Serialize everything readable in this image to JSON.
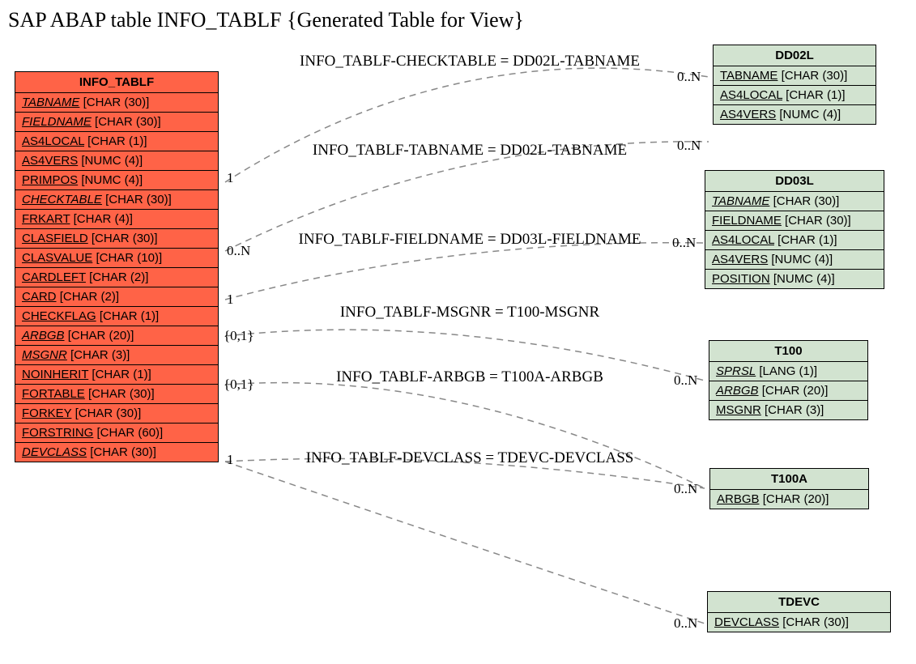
{
  "title": "SAP ABAP table INFO_TABLF {Generated Table for View}",
  "main_entity": {
    "name": "INFO_TABLF",
    "fields": [
      {
        "name": "TABNAME",
        "type": "[CHAR (30)]",
        "italic": true
      },
      {
        "name": "FIELDNAME",
        "type": "[CHAR (30)]",
        "italic": true
      },
      {
        "name": "AS4LOCAL",
        "type": "[CHAR (1)]"
      },
      {
        "name": "AS4VERS",
        "type": "[NUMC (4)]"
      },
      {
        "name": "PRIMPOS",
        "type": "[NUMC (4)]"
      },
      {
        "name": "CHECKTABLE",
        "type": "[CHAR (30)]",
        "italic": true
      },
      {
        "name": "FRKART",
        "type": "[CHAR (4)]"
      },
      {
        "name": "CLASFIELD",
        "type": "[CHAR (30)]"
      },
      {
        "name": "CLASVALUE",
        "type": "[CHAR (10)]"
      },
      {
        "name": "CARDLEFT",
        "type": "[CHAR (2)]"
      },
      {
        "name": "CARD",
        "type": "[CHAR (2)]"
      },
      {
        "name": "CHECKFLAG",
        "type": "[CHAR (1)]"
      },
      {
        "name": "ARBGB",
        "type": "[CHAR (20)]",
        "italic": true
      },
      {
        "name": "MSGNR",
        "type": "[CHAR (3)]",
        "italic": true
      },
      {
        "name": "NOINHERIT",
        "type": "[CHAR (1)]"
      },
      {
        "name": "FORTABLE",
        "type": "[CHAR (30)]"
      },
      {
        "name": "FORKEY",
        "type": "[CHAR (30)]"
      },
      {
        "name": "FORSTRING",
        "type": "[CHAR (60)]"
      },
      {
        "name": "DEVCLASS",
        "type": "[CHAR (30)]",
        "italic": true
      }
    ]
  },
  "ref_entities": [
    {
      "name": "DD02L",
      "fields": [
        {
          "name": "TABNAME",
          "type": "[CHAR (30)]"
        },
        {
          "name": "AS4LOCAL",
          "type": "[CHAR (1)]"
        },
        {
          "name": "AS4VERS",
          "type": "[NUMC (4)]"
        }
      ]
    },
    {
      "name": "DD03L",
      "fields": [
        {
          "name": "TABNAME",
          "type": "[CHAR (30)]",
          "italic": true
        },
        {
          "name": "FIELDNAME",
          "type": "[CHAR (30)]"
        },
        {
          "name": "AS4LOCAL",
          "type": "[CHAR (1)]"
        },
        {
          "name": "AS4VERS",
          "type": "[NUMC (4)]"
        },
        {
          "name": "POSITION",
          "type": "[NUMC (4)]"
        }
      ]
    },
    {
      "name": "T100",
      "fields": [
        {
          "name": "SPRSL",
          "type": "[LANG (1)]",
          "italic": true
        },
        {
          "name": "ARBGB",
          "type": "[CHAR (20)]",
          "italic": true
        },
        {
          "name": "MSGNR",
          "type": "[CHAR (3)]"
        }
      ]
    },
    {
      "name": "T100A",
      "fields": [
        {
          "name": "ARBGB",
          "type": "[CHAR (20)]"
        }
      ]
    },
    {
      "name": "TDEVC",
      "fields": [
        {
          "name": "DEVCLASS",
          "type": "[CHAR (30)]"
        }
      ]
    }
  ],
  "relations": [
    {
      "label": "INFO_TABLF-CHECKTABLE = DD02L-TABNAME",
      "left_card": "1",
      "right_card": "0..N"
    },
    {
      "label": "INFO_TABLF-TABNAME = DD02L-TABNAME",
      "left_card": "0..N",
      "right_card": "0..N"
    },
    {
      "label": "INFO_TABLF-FIELDNAME = DD03L-FIELDNAME",
      "left_card": "1",
      "right_card": "0..N"
    },
    {
      "label": "INFO_TABLF-MSGNR = T100-MSGNR",
      "left_card": "{0,1}",
      "right_card": ""
    },
    {
      "label": "INFO_TABLF-ARBGB = T100A-ARBGB",
      "left_card": "{0,1}",
      "right_card": "0..N"
    },
    {
      "label": "INFO_TABLF-DEVCLASS = TDEVC-DEVCLASS",
      "left_card": "1",
      "right_card": "0..N"
    }
  ],
  "extra_cards": {
    "tdevc_right": "0..N"
  }
}
